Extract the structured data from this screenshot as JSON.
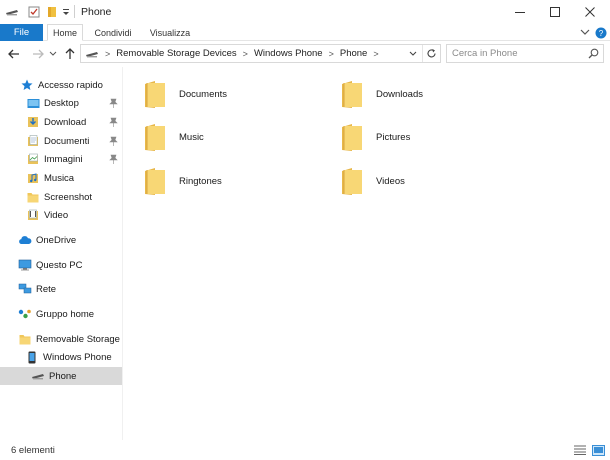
{
  "window": {
    "title": "Phone",
    "minimize_icon": "minimize-icon",
    "maximize_icon": "maximize-icon",
    "close_icon": "close-icon"
  },
  "quick_access_toolbar": {
    "items": [
      "drive-icon",
      "properties-check-icon",
      "new-folder-icon",
      "customize-dropdown-icon"
    ]
  },
  "ribbon": {
    "file_label": "File",
    "tabs": [
      {
        "label": "Home"
      },
      {
        "label": "Condividi"
      },
      {
        "label": "Visualizza"
      }
    ],
    "expand_icon": "chevron-down-icon",
    "help_icon": "help-icon"
  },
  "navigation": {
    "back_icon": "arrow-left-icon",
    "forward_icon": "arrow-right-icon",
    "recent_icon": "chevron-down-icon",
    "up_icon": "arrow-up-icon"
  },
  "address_bar": {
    "breadcrumbs": [
      "Removable Storage Devices",
      "Windows Phone",
      "Phone"
    ],
    "separator": ">",
    "dropdown_icon": "chevron-down-icon",
    "refresh_icon": "refresh-icon"
  },
  "search": {
    "placeholder": "Cerca in Phone",
    "icon": "search-icon"
  },
  "nav_pane": {
    "items": [
      {
        "label": "Accesso rapido",
        "icon": "star-icon",
        "pinned": false
      },
      {
        "label": "Desktop",
        "icon": "folder-icon",
        "pinned": true
      },
      {
        "label": "Download",
        "icon": "download-folder-icon",
        "pinned": true
      },
      {
        "label": "Documenti",
        "icon": "documents-folder-icon",
        "pinned": true
      },
      {
        "label": "Immagini",
        "icon": "pictures-folder-icon",
        "pinned": true
      },
      {
        "label": "Musica",
        "icon": "music-folder-icon",
        "pinned": false
      },
      {
        "label": "Screenshot",
        "icon": "folder-icon",
        "pinned": false
      },
      {
        "label": "Video",
        "icon": "video-folder-icon",
        "pinned": false
      },
      {
        "label": "OneDrive",
        "icon": "cloud-icon",
        "pinned": false
      },
      {
        "label": "Questo PC",
        "icon": "computer-icon",
        "pinned": false
      },
      {
        "label": "Rete",
        "icon": "network-icon",
        "pinned": false
      },
      {
        "label": "Gruppo home",
        "icon": "homegroup-icon",
        "pinned": false
      },
      {
        "label": "Removable Storage D",
        "icon": "folder-icon",
        "pinned": false
      },
      {
        "label": "Windows Phone",
        "icon": "phone-icon",
        "pinned": false
      },
      {
        "label": "Phone",
        "icon": "drive-icon",
        "pinned": false,
        "selected": true
      }
    ]
  },
  "folders": [
    {
      "label": "Documents"
    },
    {
      "label": "Downloads"
    },
    {
      "label": "Music"
    },
    {
      "label": "Pictures"
    },
    {
      "label": "Ringtones"
    },
    {
      "label": "Videos"
    }
  ],
  "status_bar": {
    "count_text": "6 elementi",
    "details_view_icon": "details-view-icon",
    "large_icons_view_icon": "large-icons-view-icon"
  },
  "colors": {
    "accent": "#1979ca",
    "folder_yellow": "#f8d775",
    "folder_dark": "#e8b84a",
    "selection": "#d9d9d9"
  }
}
